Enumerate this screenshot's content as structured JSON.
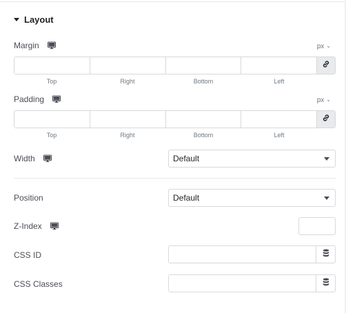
{
  "section": {
    "title": "Layout"
  },
  "margin": {
    "label": "Margin",
    "unit": "px",
    "fields": [
      {
        "value": "",
        "label": "Top"
      },
      {
        "value": "",
        "label": "Right"
      },
      {
        "value": "",
        "label": "Bottom"
      },
      {
        "value": "",
        "label": "Left"
      }
    ]
  },
  "padding": {
    "label": "Padding",
    "unit": "px",
    "fields": [
      {
        "value": "",
        "label": "Top"
      },
      {
        "value": "",
        "label": "Right"
      },
      {
        "value": "",
        "label": "Bottom"
      },
      {
        "value": "",
        "label": "Left"
      }
    ]
  },
  "width": {
    "label": "Width",
    "value": "Default"
  },
  "position": {
    "label": "Position",
    "value": "Default"
  },
  "zindex": {
    "label": "Z-Index",
    "value": ""
  },
  "css_id": {
    "label": "CSS ID",
    "value": ""
  },
  "css_classes": {
    "label": "CSS Classes",
    "value": ""
  },
  "icons": {
    "section_toggle": "caret-down-icon",
    "responsive": "desktop-monitor-icon",
    "link": "link-icon",
    "dynamic": "database-icon",
    "unit_dropdown": "chevron-down-icon"
  },
  "colors": {
    "border": "#d5d8dc",
    "link_bg": "#e9eaec",
    "text": "#4a4d55",
    "title": "#1f2124"
  }
}
